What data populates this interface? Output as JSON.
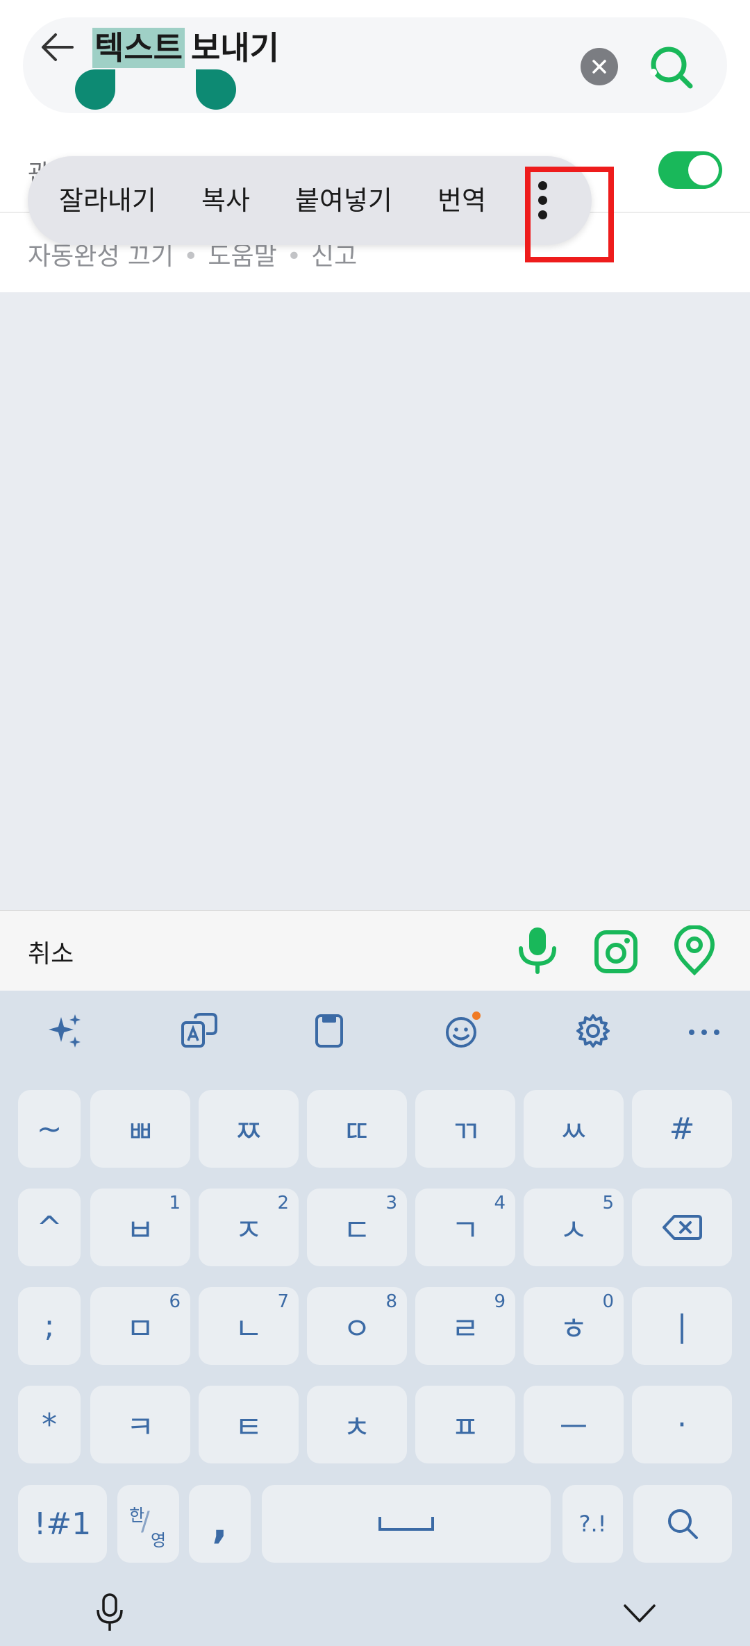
{
  "search": {
    "selected_text": "텍스트",
    "rest_text": "보내기"
  },
  "row": {
    "left_text": "관"
  },
  "footer_links": [
    "자동완성 끄기",
    "도움말",
    "신고"
  ],
  "context_menu": {
    "items": [
      "잘라내기",
      "복사",
      "붙여넣기",
      "번역"
    ]
  },
  "action_bar": {
    "cancel_label": "취소"
  },
  "keyboard": {
    "rows": [
      [
        {
          "label": "~"
        },
        {
          "label": "ㅃ"
        },
        {
          "label": "ㅉ"
        },
        {
          "label": "ㄸ"
        },
        {
          "label": "ㄲ"
        },
        {
          "label": "ㅆ"
        },
        {
          "label": "#"
        }
      ],
      [
        {
          "label": "^"
        },
        {
          "label": "ㅂ",
          "num": "1"
        },
        {
          "label": "ㅈ",
          "num": "2"
        },
        {
          "label": "ㄷ",
          "num": "3"
        },
        {
          "label": "ㄱ",
          "num": "4"
        },
        {
          "label": "ㅅ",
          "num": "5"
        },
        {
          "label": ""
        }
      ],
      [
        {
          "label": ";"
        },
        {
          "label": "ㅁ",
          "num": "6"
        },
        {
          "label": "ㄴ",
          "num": "7"
        },
        {
          "label": "ㅇ",
          "num": "8"
        },
        {
          "label": "ㄹ",
          "num": "9"
        },
        {
          "label": "ㅎ",
          "num": "0"
        },
        {
          "label": "|"
        }
      ],
      [
        {
          "label": "*"
        },
        {
          "label": "ㅋ"
        },
        {
          "label": "ㅌ"
        },
        {
          "label": "ㅊ"
        },
        {
          "label": "ㅍ"
        },
        {
          "label": "ㅡ"
        },
        {
          "label": "·"
        }
      ]
    ],
    "bottom": {
      "symbols_label": "!#1",
      "lang_top": "한",
      "lang_bottom": "영",
      "comma_label": ",",
      "punct_label": "?.!"
    }
  },
  "colors": {
    "accent_green": "#19b85a",
    "handle_teal": "#0d8a73",
    "highlight_red": "#ee1c1c",
    "key_text": "#3b6aa5"
  }
}
